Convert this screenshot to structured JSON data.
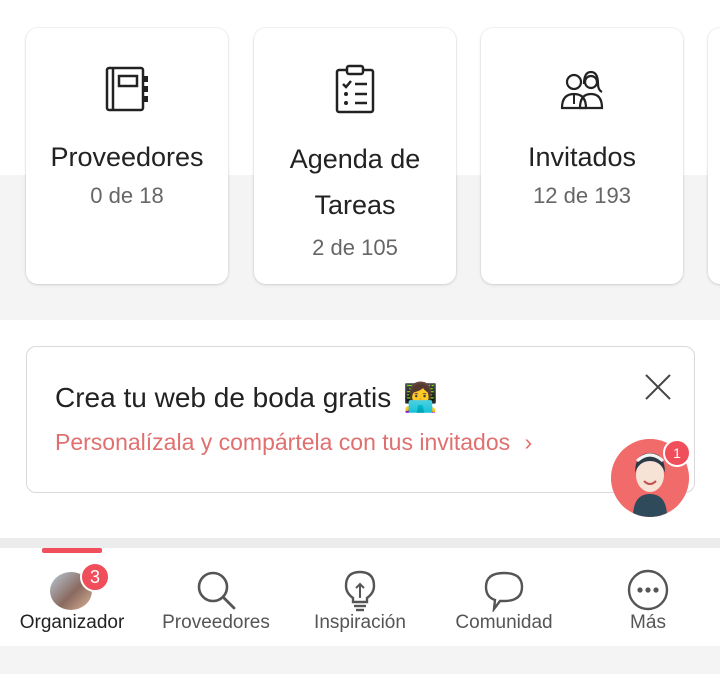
{
  "cards": [
    {
      "title": "Proveedores",
      "count": "0 de 18",
      "icon": "notebook-icon"
    },
    {
      "title_line1": "Agenda de",
      "title_line2": "Tareas",
      "count": "2 de 105",
      "icon": "clipboard-checklist-icon"
    },
    {
      "title": "Invitados",
      "count": "12 de 193",
      "icon": "couple-icon"
    }
  ],
  "promo": {
    "title": "Crea tu web de boda gratis",
    "emoji": "👩‍💻",
    "subtitle": "Personalízala y compártela con tus invitados",
    "chevron": "›"
  },
  "chat": {
    "badge": "1"
  },
  "nav": {
    "items": [
      {
        "label": "Organizador",
        "icon": "user-photo-avatar",
        "badge": "3"
      },
      {
        "label": "Proveedores",
        "icon": "search-icon"
      },
      {
        "label": "Inspiración",
        "icon": "lightbulb-icon"
      },
      {
        "label": "Comunidad",
        "icon": "chat-bubble-icon"
      },
      {
        "label": "Más",
        "icon": "more-dots-icon"
      }
    ]
  },
  "colors": {
    "accent": "#f04e5a",
    "link": "#e0706f"
  }
}
